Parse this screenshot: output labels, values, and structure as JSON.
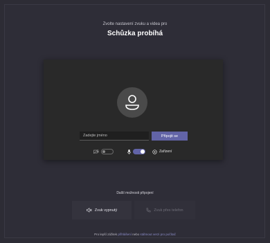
{
  "header": {
    "subtitle": "Zvolte nastavení zvuku a videa pro",
    "title": "Schůzka probíhá"
  },
  "preview": {
    "name_placeholder": "Zadejte jméno",
    "join_label": "Připojit se",
    "devices_label": "Zařízení",
    "camera_on": false,
    "mic_on": true
  },
  "other": {
    "title": "Další možnosti připojení",
    "audio_off_label": "Zvuk vypnutý",
    "phone_label": "Zvuk přes telefon"
  },
  "footer": {
    "prefix": "Pro lepší zážitek ",
    "link1": "přihlášení",
    "middle": " nebo ",
    "link2": "stáhnout verzi pro počítač"
  },
  "colors": {
    "background": "#2e2d37",
    "accent": "#6264a7",
    "panel": "#292929"
  }
}
